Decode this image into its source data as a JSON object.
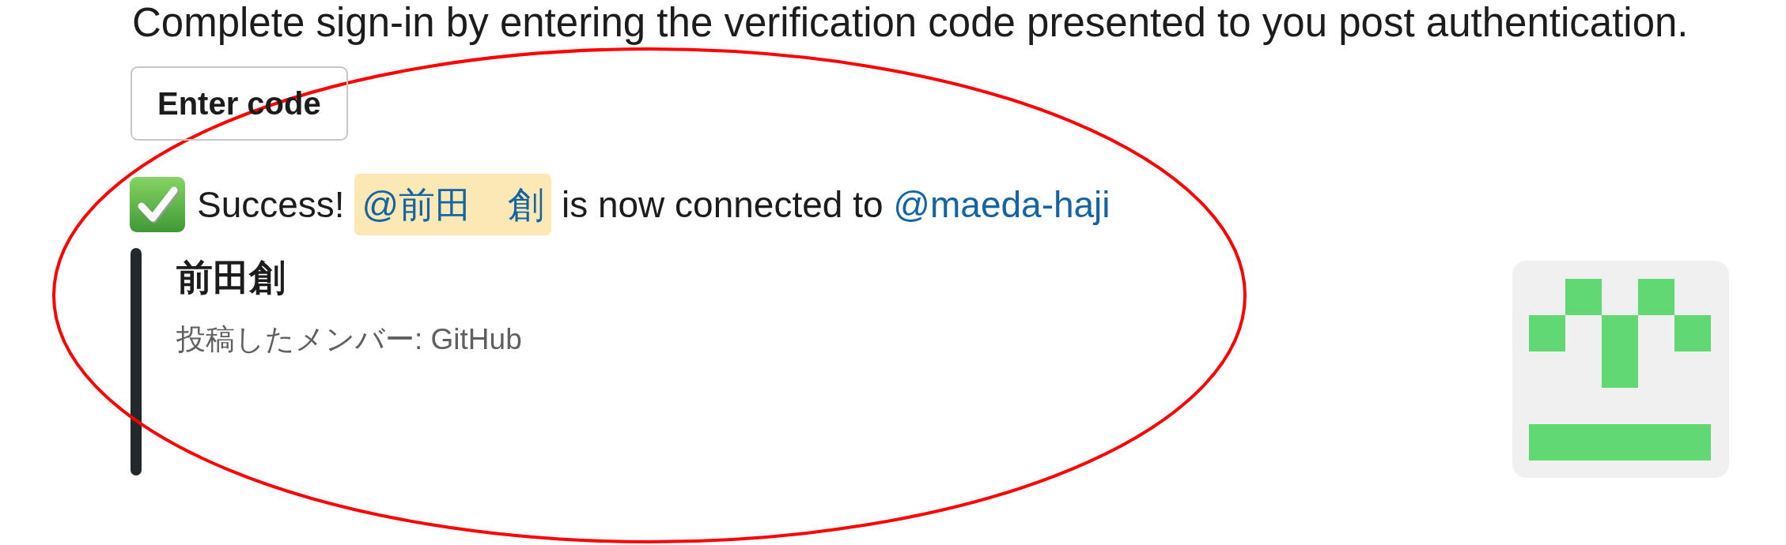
{
  "instruction": "Complete sign-in by entering the verification code presented to you post authentication.",
  "enter_code_button": {
    "label": "Enter code"
  },
  "success_message": {
    "lead": "Success!",
    "user_mention": {
      "text": "@前田　創",
      "highlighted": true
    },
    "middle": "is now connected to",
    "account_mention": {
      "text": "@maeda-haji",
      "highlighted": false
    }
  },
  "attachment": {
    "title": "前田創",
    "footer": "投稿したメンバー: GitHub"
  },
  "annotations": [
    {
      "kind": "ellipse"
    }
  ]
}
